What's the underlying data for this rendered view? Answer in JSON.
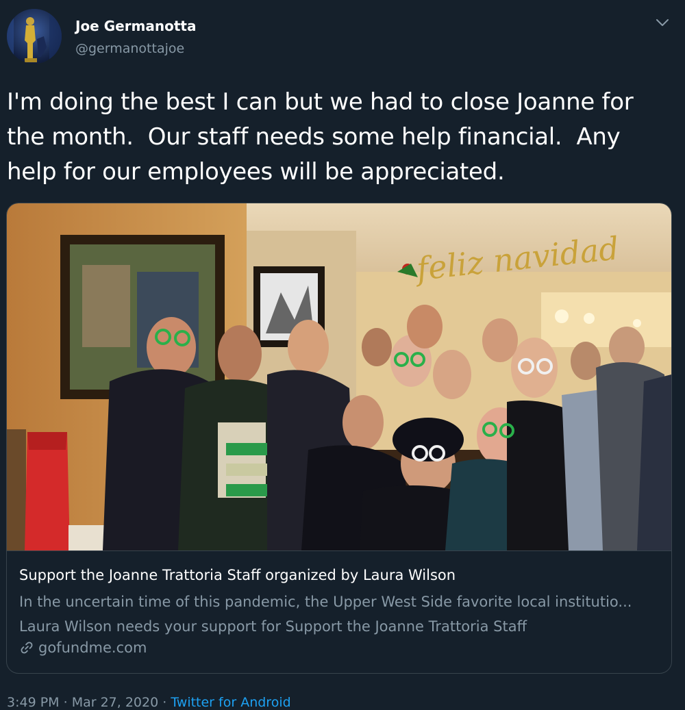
{
  "author": {
    "display_name": "Joe Germanotta",
    "handle": "@germanottajoe",
    "avatar_icon": "oscar-statue-avatar"
  },
  "tweet": {
    "text": "I'm doing the best I can but we had to close Joanne for\nthe month.  Our staff needs some help financial.  Any\nhelp for our employees will be appreciated.",
    "menu_icon": "chevron-down-icon"
  },
  "card": {
    "banner_text": "feliz  navidad",
    "title": "Support the Joanne Trattoria Staff organized by Laura Wilson",
    "description": "In the  uncertain time of this pandemic, the Upper West Side favorite local institutio... Laura Wilson needs your support for Support the Joanne Trattoria Staff",
    "domain": "gofundme.com",
    "domain_icon": "link-icon"
  },
  "meta": {
    "time": "3:49 PM",
    "separator": " · ",
    "date": "Mar 27, 2020",
    "separator2": " · ",
    "source": "Twitter for Android"
  },
  "colors": {
    "background": "#15202b",
    "secondary_text": "#8899a6",
    "border": "#38444d",
    "accent": "#1da1f2"
  }
}
